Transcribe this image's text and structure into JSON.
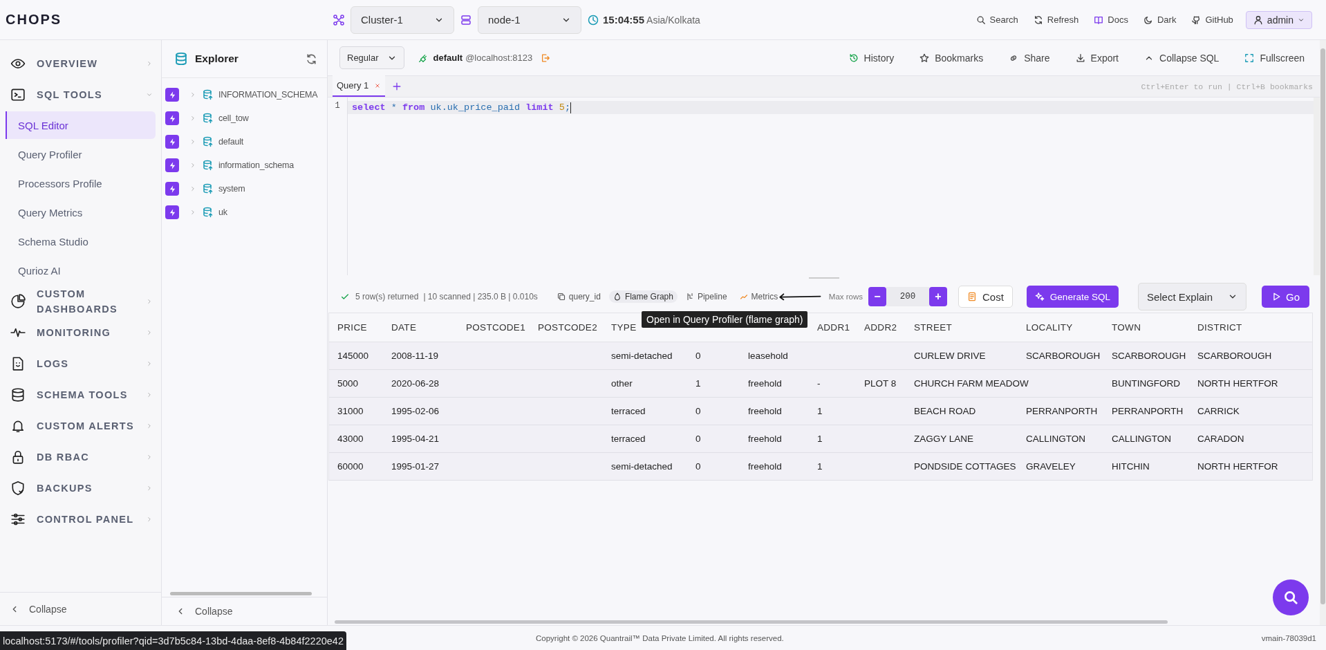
{
  "app": {
    "logo": "CHOPS"
  },
  "topbar": {
    "cluster": "Cluster-1",
    "node": "node-1",
    "time": "15:04:55",
    "timezone": "Asia/Kolkata",
    "actions": [
      "Search",
      "Refresh",
      "Docs",
      "Dark",
      "GitHub"
    ],
    "user": "admin"
  },
  "sidebar": {
    "items": [
      {
        "label": "OVERVIEW",
        "expanded": false
      },
      {
        "label": "SQL TOOLS",
        "expanded": true,
        "children": [
          {
            "label": "SQL Editor",
            "selected": true
          },
          {
            "label": "Query Profiler",
            "selected": false
          },
          {
            "label": "Processors Profile",
            "selected": false
          },
          {
            "label": "Query Metrics",
            "selected": false
          },
          {
            "label": "Schema Studio",
            "selected": false
          },
          {
            "label": "Qurioz AI",
            "selected": false
          }
        ]
      },
      {
        "label": "CUSTOM DASHBOARDS",
        "expanded": false
      },
      {
        "label": "MONITORING",
        "expanded": false
      },
      {
        "label": "LOGS",
        "expanded": false
      },
      {
        "label": "SCHEMA TOOLS",
        "expanded": false
      },
      {
        "label": "CUSTOM ALERTS",
        "expanded": false
      },
      {
        "label": "DB RBAC",
        "expanded": false
      },
      {
        "label": "BACKUPS",
        "expanded": false
      },
      {
        "label": "CONTROL PANEL",
        "expanded": false
      }
    ],
    "collapse": "Collapse"
  },
  "explorer": {
    "title": "Explorer",
    "databases": [
      "INFORMATION_SCHEMA",
      "cell_tow",
      "default",
      "information_schema",
      "system",
      "uk"
    ],
    "collapse": "Collapse"
  },
  "editor": {
    "mode": "Regular",
    "database": "default",
    "host": "@localhost:8123",
    "actions": [
      "History",
      "Bookmarks",
      "Share",
      "Export",
      "Collapse SQL",
      "Fullscreen"
    ],
    "tabs": [
      {
        "label": "Query 1",
        "selected": true
      }
    ],
    "hint": "Ctrl+Enter to run | Ctrl+B bookmarks",
    "lines": [
      {
        "number": "1",
        "tokens": [
          {
            "kind": "keyword",
            "text": "select"
          },
          {
            "kind": "plain",
            "text": " * "
          },
          {
            "kind": "keyword",
            "text": "from"
          },
          {
            "kind": "plain",
            "text": " uk.uk_price_paid "
          },
          {
            "kind": "keyword",
            "text": "limit"
          },
          {
            "kind": "number",
            "text": " 5"
          },
          {
            "kind": "plain",
            "text": ";"
          }
        ]
      }
    ]
  },
  "results": {
    "summary": "5 row(s) returned",
    "stats": "| 10 scanned | 235.0 B | 0.010s",
    "links": [
      {
        "label": "query_id",
        "selected": false
      },
      {
        "label": "Flame Graph",
        "selected": true
      },
      {
        "label": "Pipeline",
        "selected": false
      },
      {
        "label": "Metrics",
        "selected": false
      }
    ],
    "max_rows_label": "Max rows",
    "minus": "−",
    "max_rows": "200",
    "plus": "+",
    "cost": "Cost",
    "generate": "Generate SQL",
    "explain": "Select Explain",
    "go": "Go",
    "tooltip": "Open in Query Profiler (flame graph)"
  },
  "table": {
    "columns": [
      {
        "label": "PRICE"
      },
      {
        "label": "DATE"
      },
      {
        "label": "POSTCODE1"
      },
      {
        "label": "POSTCODE2"
      },
      {
        "label": "TYPE"
      },
      {},
      {},
      {
        "label": "ADDR1"
      },
      {
        "label": "ADDR2"
      },
      {
        "label": "STREET"
      },
      {
        "label": "LOCALITY"
      },
      {
        "label": "TOWN"
      },
      {
        "label": "DISTRICT"
      }
    ],
    "rows": [
      [
        "145000",
        "2008-11-19",
        "",
        "",
        "semi-detached",
        "0",
        "leasehold",
        "",
        "",
        "CURLEW DRIVE",
        "SCARBOROUGH",
        "SCARBOROUGH",
        "SCARBOROUGH"
      ],
      [
        "5000",
        "2020-06-28",
        "",
        "",
        "other",
        "1",
        "freehold",
        "-",
        "PLOT 8",
        "CHURCH FARM MEADOW",
        "",
        "BUNTINGFORD",
        "NORTH HERTFOR"
      ],
      [
        "31000",
        "1995-02-06",
        "",
        "",
        "terraced",
        "0",
        "freehold",
        "1",
        "",
        "BEACH ROAD",
        "PERRANPORTH",
        "PERRANPORTH",
        "CARRICK"
      ],
      [
        "43000",
        "1995-04-21",
        "",
        "",
        "terraced",
        "0",
        "freehold",
        "1",
        "",
        "ZAGGY LANE",
        "CALLINGTON",
        "CALLINGTON",
        "CARADON"
      ],
      [
        "60000",
        "1995-01-27",
        "",
        "",
        "semi-detached",
        "0",
        "freehold",
        "1",
        "",
        "PONDSIDE COTTAGES",
        "GRAVELEY",
        "HITCHIN",
        "NORTH HERTFOR"
      ]
    ]
  },
  "footer": {
    "copyright": "Copyright © 2026 Quantrail™ Data Private Limited. All rights reserved.",
    "version": "vmain-78039d1",
    "status_url": "localhost:5173/#/tools/profiler?qid=3d7b5c84-13bd-4daa-8ef8-4b84f2220e42"
  }
}
